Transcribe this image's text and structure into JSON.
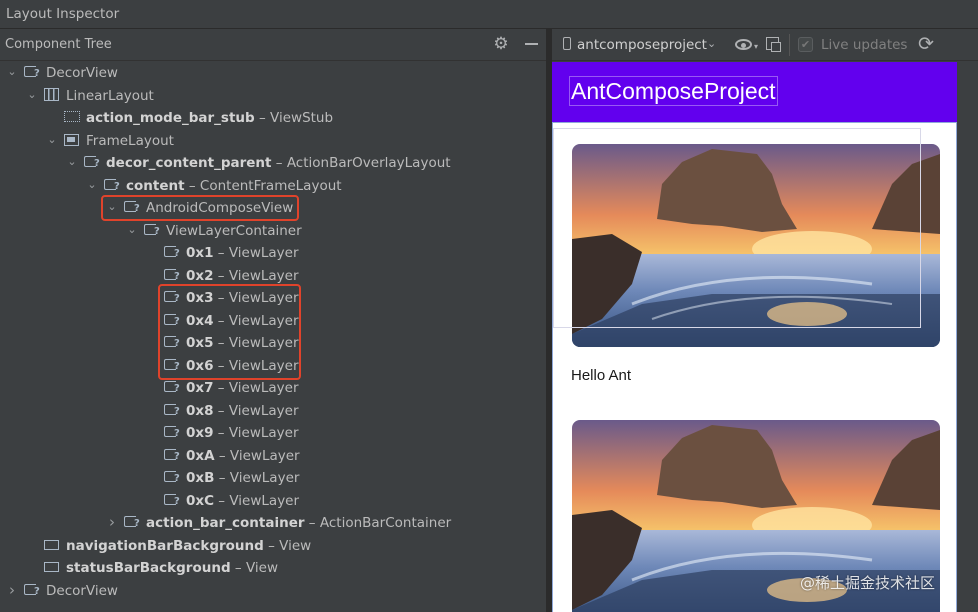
{
  "window": {
    "title": "Layout Inspector"
  },
  "component_tree": {
    "header": "Component Tree",
    "icons": {
      "settings": "gear-icon",
      "hide": "minimize-icon"
    },
    "nodes": [
      {
        "name": "DecorView",
        "type": "",
        "expanded": true,
        "icon": "compose-icon"
      },
      {
        "name": "LinearLayout",
        "type": "",
        "expanded": true,
        "icon": "linear-layout-icon"
      },
      {
        "name": "action_mode_bar_stub",
        "type": "ViewStub",
        "icon": "view-stub-icon"
      },
      {
        "name": "FrameLayout",
        "type": "",
        "expanded": true,
        "icon": "frame-layout-icon"
      },
      {
        "name": "decor_content_parent",
        "type": "ActionBarOverlayLayout",
        "expanded": true,
        "icon": "compose-icon"
      },
      {
        "name": "content",
        "type": "ContentFrameLayout",
        "expanded": true,
        "icon": "compose-icon"
      },
      {
        "name": "AndroidComposeView",
        "type": "",
        "expanded": true,
        "icon": "compose-icon",
        "highlighted": true
      },
      {
        "name": "ViewLayerContainer",
        "type": "",
        "expanded": true,
        "icon": "compose-icon"
      },
      {
        "name": "0x1",
        "type": "ViewLayer",
        "icon": "compose-icon"
      },
      {
        "name": "0x2",
        "type": "ViewLayer",
        "icon": "compose-icon"
      },
      {
        "name": "0x3",
        "type": "ViewLayer",
        "icon": "compose-icon",
        "highlighted": true
      },
      {
        "name": "0x4",
        "type": "ViewLayer",
        "icon": "compose-icon",
        "highlighted": true
      },
      {
        "name": "0x5",
        "type": "ViewLayer",
        "icon": "compose-icon",
        "highlighted": true
      },
      {
        "name": "0x6",
        "type": "ViewLayer",
        "icon": "compose-icon",
        "highlighted": true
      },
      {
        "name": "0x7",
        "type": "ViewLayer",
        "icon": "compose-icon"
      },
      {
        "name": "0x8",
        "type": "ViewLayer",
        "icon": "compose-icon"
      },
      {
        "name": "0x9",
        "type": "ViewLayer",
        "icon": "compose-icon"
      },
      {
        "name": "0xA",
        "type": "ViewLayer",
        "icon": "compose-icon"
      },
      {
        "name": "0xB",
        "type": "ViewLayer",
        "icon": "compose-icon"
      },
      {
        "name": "0xC",
        "type": "ViewLayer",
        "icon": "compose-icon"
      },
      {
        "name": "action_bar_container",
        "type": "ActionBarContainer",
        "expanded": false,
        "icon": "compose-icon"
      },
      {
        "name": "navigationBarBackground",
        "type": "View",
        "icon": "view-icon"
      },
      {
        "name": "statusBarBackground",
        "type": "View",
        "icon": "view-icon"
      },
      {
        "name": "DecorView",
        "type": "",
        "expanded": false,
        "icon": "compose-icon"
      }
    ]
  },
  "toolbar": {
    "device": "antcomposeproject",
    "live_updates": "Live updates",
    "live_updates_checked": true,
    "icons": [
      "phone-icon",
      "chevron-down-icon",
      "eye-icon",
      "export-icon",
      "refresh-icon"
    ]
  },
  "preview": {
    "app_title": "AntComposeProject",
    "app_bar_color": "#6200ee",
    "item_text": "Hello Ant",
    "images": [
      "coastal-sunset-photo",
      "coastal-sunset-photo"
    ],
    "watermark": "@稀土掘金技术社区"
  }
}
